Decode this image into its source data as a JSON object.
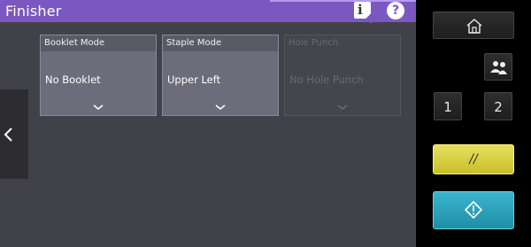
{
  "header": {
    "title": "Finisher"
  },
  "options": [
    {
      "label": "Booklet Mode",
      "value": "No Booklet",
      "enabled": true
    },
    {
      "label": "Staple Mode",
      "value": "Upper Left",
      "enabled": true
    },
    {
      "label": "Hole Punch",
      "value": "No Hole Punch",
      "enabled": false
    }
  ],
  "keypad": {
    "key1": "1",
    "key2": "2",
    "clear_symbol": "//"
  },
  "colors": {
    "title_bar": "#7b57c2",
    "panel": "#414249",
    "clear_key": "#dcd340",
    "start_key": "#2aa3bd"
  },
  "icons": {
    "info": "info-icon",
    "help": "help-icon",
    "home": "home-icon",
    "users": "users-icon",
    "back": "chevron-left-icon",
    "start": "diamond-start-icon"
  }
}
